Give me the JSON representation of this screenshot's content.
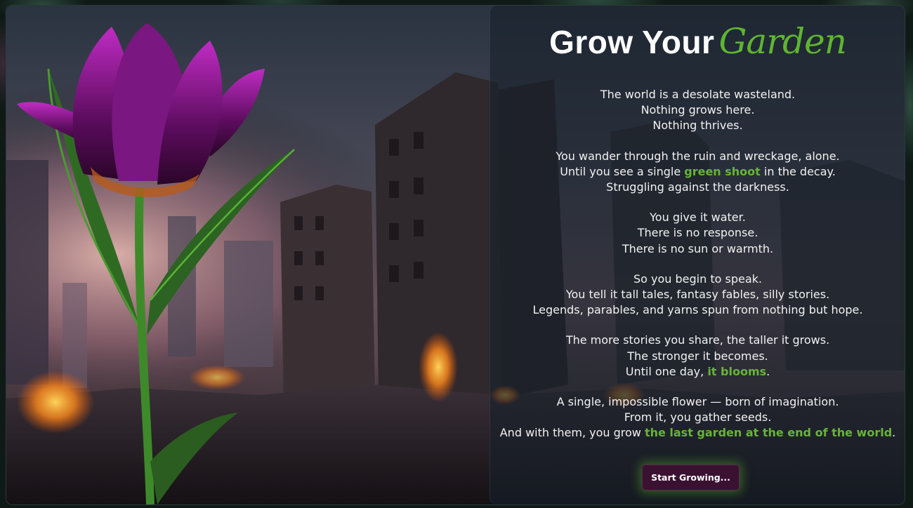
{
  "page": {
    "title_main": "Grow Your",
    "title_accent": "Garden"
  },
  "story": {
    "s1": [
      "The world is a desolate wasteland.",
      "Nothing grows here.",
      "Nothing thrives."
    ],
    "s2": {
      "l1": "You wander through the ruin and wreckage, alone.",
      "l2_pre": "Until you see a single ",
      "l2_hl": "green shoot",
      "l2_post": " in the decay.",
      "l3": "Struggling against the darkness."
    },
    "s3": [
      "You give it water.",
      "There is no response.",
      "There is no sun or warmth."
    ],
    "s4": [
      "So you begin to speak.",
      "You tell it tall tales, fantasy fables, silly stories.",
      "Legends, parables, and yarns spun from nothing but hope."
    ],
    "s5": {
      "l1": "The more stories you share, the taller it grows.",
      "l2": "The stronger it becomes.",
      "l3_pre": "Until one day, ",
      "l3_hl": "it blooms",
      "l3_post": "."
    },
    "s6": {
      "l1": "A single, impossible flower — born of imagination.",
      "l2": "From it, you gather seeds.",
      "l3_pre": "And with them, you grow ",
      "l3_hl": "the last garden at the end of the world",
      "l3_post": "."
    }
  },
  "start_button": {
    "label": "Start Growing..."
  },
  "colors": {
    "accent_green": "#5fb532",
    "button_bg": "#3b1131",
    "tulip_purple": "#8a1a8c"
  },
  "icons": [
    "tulip-illustration",
    "ruined-city-illustration"
  ]
}
